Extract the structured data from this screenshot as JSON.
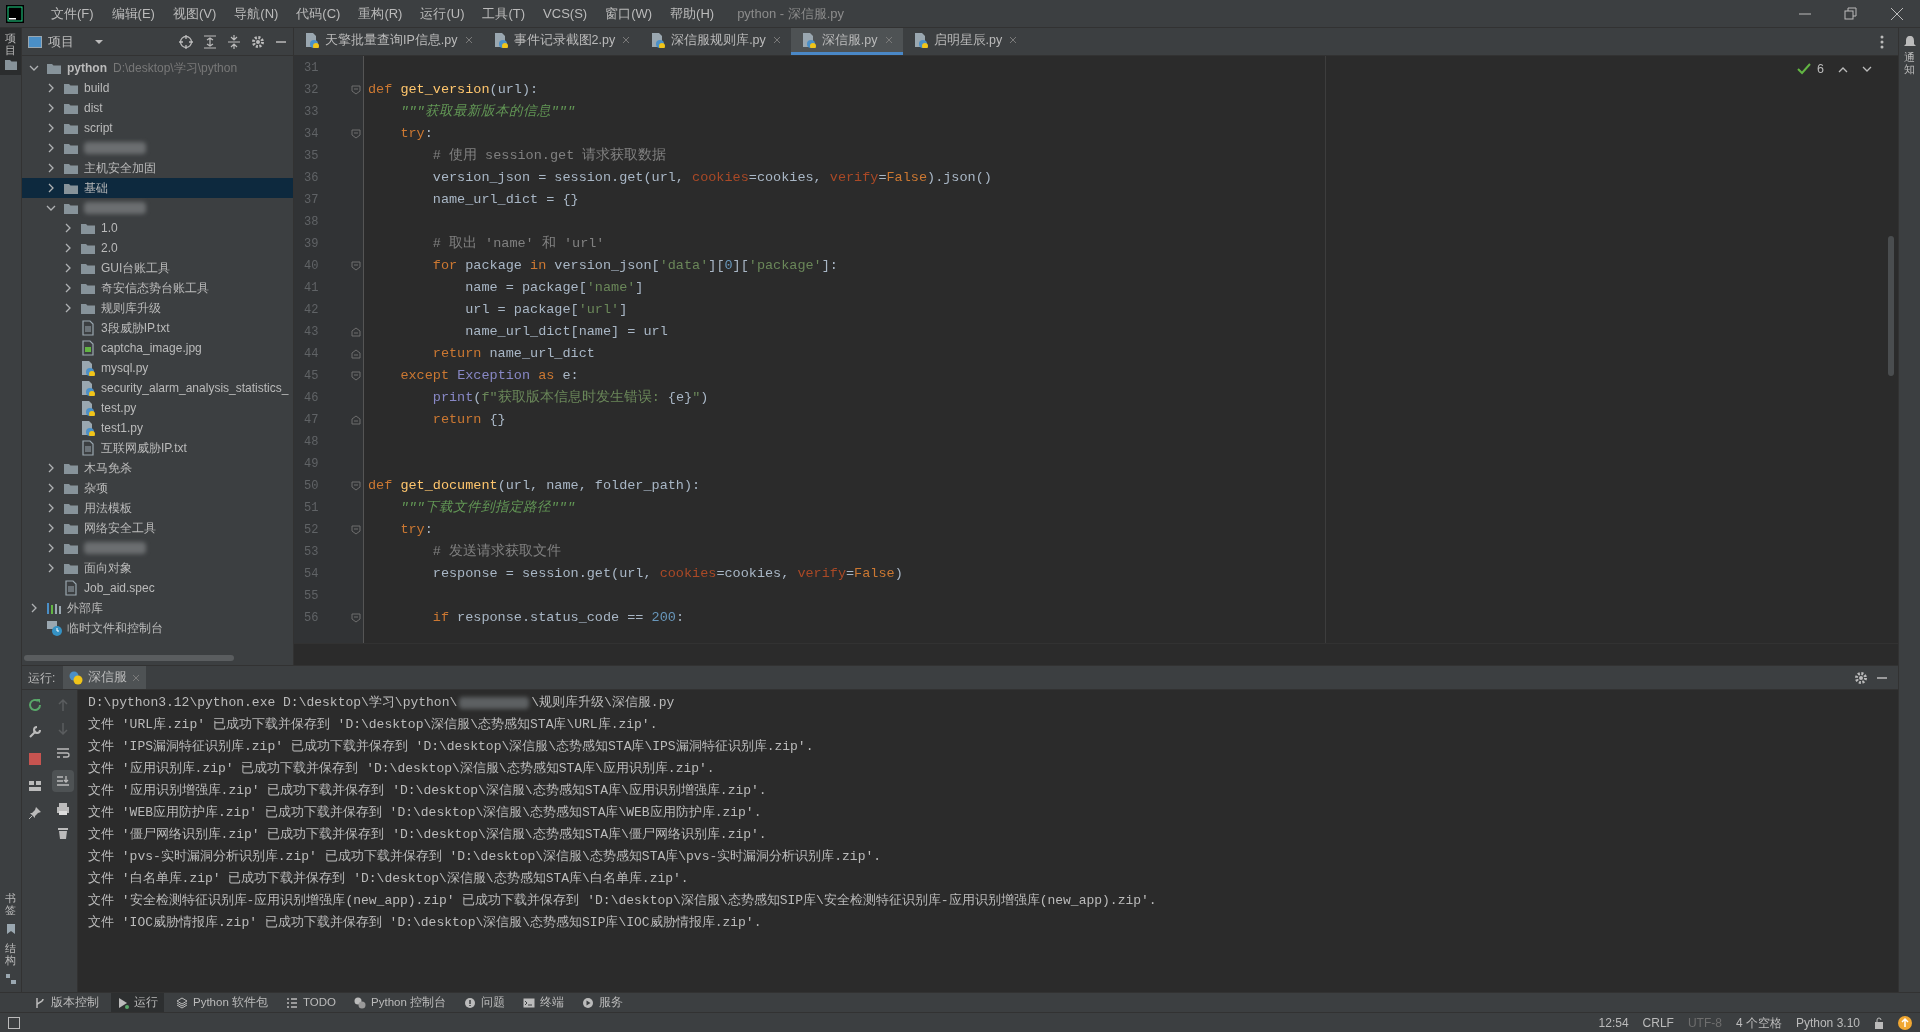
{
  "window": {
    "title": "python - 深信服.py"
  },
  "menu": [
    "文件(F)",
    "编辑(E)",
    "视图(V)",
    "导航(N)",
    "代码(C)",
    "重构(R)",
    "运行(U)",
    "工具(T)",
    "VCS(S)",
    "窗口(W)",
    "帮助(H)"
  ],
  "left_strip": {
    "top": "项目",
    "bottom": [
      "书签",
      "结构"
    ]
  },
  "right_strip": {
    "label": "通知"
  },
  "project": {
    "title": "项目",
    "tree": [
      {
        "kind": "folder",
        "label": "python",
        "path": "D:\\desktop\\学习\\python",
        "expanded": true,
        "selected": false,
        "children": [
          {
            "kind": "folder",
            "label": "build",
            "expanded": false,
            "selected": false
          },
          {
            "kind": "folder",
            "label": "dist",
            "expanded": false,
            "selected": false
          },
          {
            "kind": "folder",
            "label": "script",
            "expanded": false,
            "selected": false
          },
          {
            "kind": "folder",
            "redacted": true,
            "expanded": false,
            "selected": false
          },
          {
            "kind": "folder",
            "label": "主机安全加固",
            "expanded": false,
            "selected": false
          },
          {
            "kind": "folder",
            "label": "基础",
            "expanded": false,
            "selected": true
          },
          {
            "kind": "folder",
            "redacted": true,
            "expanded": true,
            "selected": false,
            "children": [
              {
                "kind": "folder",
                "label": "1.0",
                "expanded": false,
                "selected": false
              },
              {
                "kind": "folder",
                "label": "2.0",
                "expanded": false,
                "selected": false
              },
              {
                "kind": "folder",
                "label": "GUI台账工具",
                "expanded": false,
                "selected": false
              },
              {
                "kind": "folder",
                "label": "奇安信态势台账工具",
                "expanded": false,
                "selected": false
              },
              {
                "kind": "folder",
                "label": "规则库升级",
                "expanded": false,
                "selected": false
              },
              {
                "kind": "text",
                "label": "3段威胁IP.txt",
                "selected": false
              },
              {
                "kind": "image",
                "label": "captcha_image.jpg",
                "selected": false
              },
              {
                "kind": "python",
                "label": "mysql.py",
                "selected": false
              },
              {
                "kind": "python",
                "label": "security_alarm_analysis_statistics_",
                "selected": false
              },
              {
                "kind": "python",
                "label": "test.py",
                "selected": false
              },
              {
                "kind": "python",
                "label": "test1.py",
                "selected": false
              },
              {
                "kind": "text",
                "label": "互联网威胁IP.txt",
                "selected": false
              }
            ]
          },
          {
            "kind": "folder",
            "label": "木马免杀",
            "expanded": false,
            "selected": false
          },
          {
            "kind": "folder",
            "label": "杂项",
            "expanded": false,
            "selected": false
          },
          {
            "kind": "folder",
            "label": "用法模板",
            "expanded": false,
            "selected": false
          },
          {
            "kind": "folder",
            "label": "网络安全工具",
            "expanded": false,
            "selected": false
          },
          {
            "kind": "folder",
            "redacted": true,
            "expanded": false,
            "selected": false
          },
          {
            "kind": "folder",
            "label": "面向对象",
            "expanded": false,
            "selected": false
          },
          {
            "kind": "text",
            "label": "Job_aid.spec",
            "selected": false
          }
        ]
      },
      {
        "kind": "library",
        "label": "外部库",
        "expanded": false,
        "selected": false
      },
      {
        "kind": "scratch",
        "label": "临时文件和控制台",
        "selected": false
      }
    ]
  },
  "tabs": [
    {
      "label": "天擎批量查询IP信息.py",
      "selected": false
    },
    {
      "label": "事件记录截图2.py",
      "selected": false
    },
    {
      "label": "深信服规则库.py",
      "selected": false
    },
    {
      "label": "深信服.py",
      "selected": true
    },
    {
      "label": "启明星辰.py",
      "selected": false
    }
  ],
  "inspection": {
    "count": "6"
  },
  "code": [
    {
      "number": "31",
      "kind": "line"
    },
    {
      "number": "32",
      "kind": "foldstart",
      "tokens": [
        {
          "kind": "keyword",
          "text": "def "
        },
        {
          "kind": "function",
          "text": "get_version"
        },
        {
          "kind": "plain",
          "text": "(url):"
        }
      ]
    },
    {
      "number": "33",
      "kind": "line",
      "tokens": [
        {
          "kind": "docstring",
          "text": "    \"\"\"获取最新版本的信息\"\"\""
        }
      ]
    },
    {
      "number": "34",
      "kind": "foldstart",
      "tokens": [
        {
          "kind": "keyword",
          "text": "    try"
        },
        {
          "kind": "plain",
          "text": ":"
        }
      ]
    },
    {
      "number": "35",
      "kind": "line",
      "tokens": [
        {
          "kind": "comment",
          "text": "        # 使用 session.get 请求获取数据"
        }
      ]
    },
    {
      "number": "36",
      "kind": "line",
      "tokens": [
        {
          "kind": "plain",
          "text": "        version_json = session.get(url, "
        },
        {
          "kind": "param",
          "text": "cookies"
        },
        {
          "kind": "plain",
          "text": "=cookies, "
        },
        {
          "kind": "param",
          "text": "verify"
        },
        {
          "kind": "plain",
          "text": "="
        },
        {
          "kind": "keyword",
          "text": "False"
        },
        {
          "kind": "plain",
          "text": ").json()"
        }
      ]
    },
    {
      "number": "37",
      "kind": "line",
      "tokens": [
        {
          "kind": "plain",
          "text": "        name_url_dict = {}"
        }
      ]
    },
    {
      "number": "38",
      "kind": "line"
    },
    {
      "number": "39",
      "kind": "line",
      "tokens": [
        {
          "kind": "comment",
          "text": "        # 取出 'name' 和 'url'"
        }
      ]
    },
    {
      "number": "40",
      "kind": "foldstart",
      "tokens": [
        {
          "kind": "keyword",
          "text": "        for"
        },
        {
          "kind": "plain",
          "text": " package "
        },
        {
          "kind": "keyword",
          "text": "in"
        },
        {
          "kind": "plain",
          "text": " version_json["
        },
        {
          "kind": "string",
          "text": "'data'"
        },
        {
          "kind": "plain",
          "text": "]["
        },
        {
          "kind": "number",
          "text": "0"
        },
        {
          "kind": "plain",
          "text": "]["
        },
        {
          "kind": "string",
          "text": "'package'"
        },
        {
          "kind": "plain",
          "text": "]:"
        }
      ]
    },
    {
      "number": "41",
      "kind": "line",
      "tokens": [
        {
          "kind": "plain",
          "text": "            name = package["
        },
        {
          "kind": "string",
          "text": "'name'"
        },
        {
          "kind": "plain",
          "text": "]"
        }
      ]
    },
    {
      "number": "42",
      "kind": "line",
      "tokens": [
        {
          "kind": "plain",
          "text": "            url = package["
        },
        {
          "kind": "string",
          "text": "'url'"
        },
        {
          "kind": "plain",
          "text": "]"
        }
      ]
    },
    {
      "number": "43",
      "kind": "foldend",
      "tokens": [
        {
          "kind": "plain",
          "text": "            name_url_dict[name] = url"
        }
      ]
    },
    {
      "number": "44",
      "kind": "foldend",
      "tokens": [
        {
          "kind": "keyword",
          "text": "        return"
        },
        {
          "kind": "plain",
          "text": " name_url_dict"
        }
      ]
    },
    {
      "number": "45",
      "kind": "foldstart",
      "tokens": [
        {
          "kind": "keyword",
          "text": "    except "
        },
        {
          "kind": "builtin",
          "text": "Exception "
        },
        {
          "kind": "keyword",
          "text": "as"
        },
        {
          "kind": "plain",
          "text": " e:"
        }
      ]
    },
    {
      "number": "46",
      "kind": "line",
      "tokens": [
        {
          "kind": "builtin",
          "text": "        print"
        },
        {
          "kind": "plain",
          "text": "("
        },
        {
          "kind": "string",
          "text": "f\"获取版本信息时发生错误: "
        },
        {
          "kind": "plain",
          "text": "{e}"
        },
        {
          "kind": "string",
          "text": "\""
        },
        {
          "kind": "plain",
          "text": ")"
        }
      ]
    },
    {
      "number": "47",
      "kind": "foldend",
      "tokens": [
        {
          "kind": "keyword",
          "text": "        return"
        },
        {
          "kind": "plain",
          "text": " {}"
        }
      ]
    },
    {
      "number": "48",
      "kind": "line"
    },
    {
      "number": "49",
      "kind": "line"
    },
    {
      "number": "50",
      "kind": "foldstart",
      "tokens": [
        {
          "kind": "keyword",
          "text": "def "
        },
        {
          "kind": "function",
          "text": "get_document"
        },
        {
          "kind": "plain",
          "text": "(url, name, folder_path):"
        }
      ]
    },
    {
      "number": "51",
      "kind": "line",
      "tokens": [
        {
          "kind": "docstring",
          "text": "    \"\"\"下载文件到指定路径\"\"\""
        }
      ]
    },
    {
      "number": "52",
      "kind": "foldstart",
      "tokens": [
        {
          "kind": "keyword",
          "text": "    try"
        },
        {
          "kind": "plain",
          "text": ":"
        }
      ]
    },
    {
      "number": "53",
      "kind": "line",
      "tokens": [
        {
          "kind": "comment",
          "text": "        # 发送请求获取文件"
        }
      ]
    },
    {
      "number": "54",
      "kind": "line",
      "tokens": [
        {
          "kind": "plain",
          "text": "        response = session.get(url, "
        },
        {
          "kind": "param",
          "text": "cookies"
        },
        {
          "kind": "plain",
          "text": "=cookies, "
        },
        {
          "kind": "param",
          "text": "verify"
        },
        {
          "kind": "plain",
          "text": "="
        },
        {
          "kind": "keyword",
          "text": "False"
        },
        {
          "kind": "plain",
          "text": ")"
        }
      ]
    },
    {
      "number": "55",
      "kind": "line"
    },
    {
      "number": "56",
      "kind": "foldstart",
      "tokens": [
        {
          "kind": "keyword",
          "text": "        if"
        },
        {
          "kind": "plain",
          "text": " response.status_code == "
        },
        {
          "kind": "number",
          "text": "200"
        },
        {
          "kind": "plain",
          "text": ":"
        }
      ]
    }
  ],
  "run": {
    "label": "运行:",
    "tab": "深信服",
    "console": [
      {
        "parts": [
          {
            "text": "D:\\python3.12\\python.exe D:\\desktop\\学习\\python\\"
          },
          {
            "redacted": true
          },
          {
            "text": "\\规则库升级\\深信服.py"
          }
        ]
      },
      {
        "parts": [
          {
            "text": "文件 'URL库.zip' 已成功下载并保存到 'D:\\desktop\\深信服\\态势感知STA库\\URL库.zip'."
          }
        ]
      },
      {
        "parts": [
          {
            "text": "文件 'IPS漏洞特征识别库.zip' 已成功下载并保存到 'D:\\desktop\\深信服\\态势感知STA库\\IPS漏洞特征识别库.zip'."
          }
        ]
      },
      {
        "parts": [
          {
            "text": "文件 '应用识别库.zip' 已成功下载并保存到 'D:\\desktop\\深信服\\态势感知STA库\\应用识别库.zip'."
          }
        ]
      },
      {
        "parts": [
          {
            "text": "文件 '应用识别增强库.zip' 已成功下载并保存到 'D:\\desktop\\深信服\\态势感知STA库\\应用识别增强库.zip'."
          }
        ]
      },
      {
        "parts": [
          {
            "text": "文件 'WEB应用防护库.zip' 已成功下载并保存到 'D:\\desktop\\深信服\\态势感知STA库\\WEB应用防护库.zip'."
          }
        ]
      },
      {
        "parts": [
          {
            "text": "文件 '僵尸网络识别库.zip' 已成功下载并保存到 'D:\\desktop\\深信服\\态势感知STA库\\僵尸网络识别库.zip'."
          }
        ]
      },
      {
        "parts": [
          {
            "text": "文件 'pvs-实时漏洞分析识别库.zip' 已成功下载并保存到 'D:\\desktop\\深信服\\态势感知STA库\\pvs-实时漏洞分析识别库.zip'."
          }
        ]
      },
      {
        "parts": [
          {
            "text": "文件 '白名单库.zip' 已成功下载并保存到 'D:\\desktop\\深信服\\态势感知STA库\\白名单库.zip'."
          }
        ]
      },
      {
        "parts": [
          {
            "text": "文件 '安全检测特征识别库-应用识别增强库(new_app).zip' 已成功下载并保存到 'D:\\desktop\\深信服\\态势感知SIP库\\安全检测特征识别库-应用识别增强库(new_app).zip'."
          }
        ]
      },
      {
        "parts": [
          {
            "text": "文件 'IOC威胁情报库.zip' 已成功下载并保存到 'D:\\desktop\\深信服\\态势感知SIP库\\IOC威胁情报库.zip'."
          }
        ]
      }
    ]
  },
  "tool_windows": [
    {
      "kind": "vcs",
      "label": "版本控制",
      "selected": false
    },
    {
      "kind": "run",
      "label": "运行",
      "selected": true
    },
    {
      "kind": "packages",
      "label": "Python 软件包",
      "selected": false
    },
    {
      "kind": "todo",
      "label": "TODO",
      "selected": false
    },
    {
      "kind": "console",
      "label": "Python 控制台",
      "selected": false
    },
    {
      "kind": "problems",
      "label": "问题",
      "selected": false
    },
    {
      "kind": "terminal",
      "label": "终端",
      "selected": false
    },
    {
      "kind": "services",
      "label": "服务",
      "selected": false
    }
  ],
  "status_bar": [
    {
      "text": "12:54",
      "disabled": false
    },
    {
      "text": "CRLF",
      "disabled": false
    },
    {
      "text": "UTF-8",
      "disabled": true
    },
    {
      "text": "4 个空格",
      "disabled": false
    },
    {
      "text": "Python 3.10",
      "disabled": false
    }
  ]
}
